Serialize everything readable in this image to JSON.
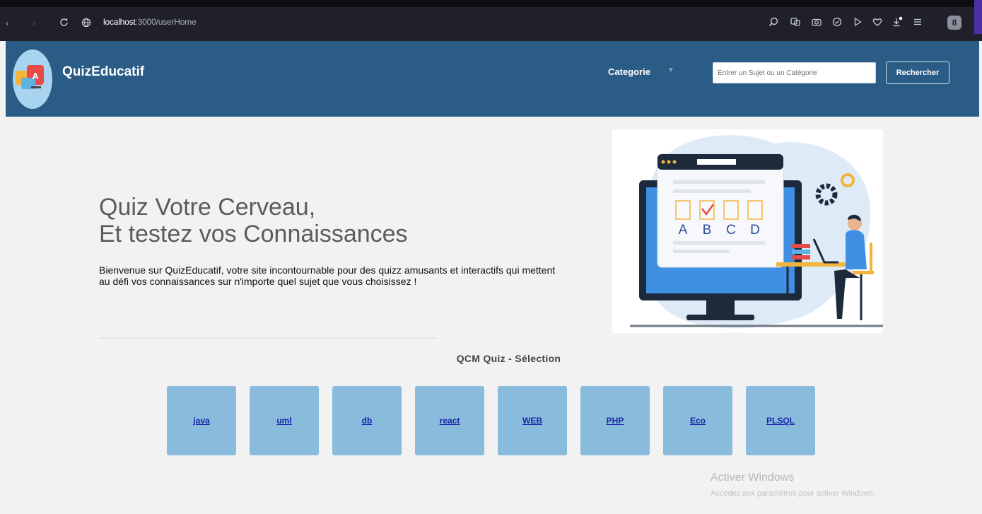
{
  "browser": {
    "url_host": "localhost",
    "url_path": ":3000/userHome",
    "profile_initial": "8",
    "toolbar_icons": [
      "zoom-icon",
      "translate-icon",
      "camera-icon",
      "check-circle-icon",
      "play-icon",
      "heart-icon",
      "download-icon",
      "menu-icon"
    ]
  },
  "header": {
    "brand": "QuizEducatif",
    "nav_category": "Categorie",
    "search_placeholder": "Entrer un Sujet ou un Catégorie",
    "search_button": "Rechercher"
  },
  "hero": {
    "title_line1": "Quiz Votre Cerveau,",
    "title_line2": "Et testez vos Connaissances",
    "description": "Bienvenue sur QuizEducatif, votre site incontournable pour des quizz amusants et interactifs qui mettent au défi vos connaissances sur n'importe quel sujet que vous choisissez !",
    "illustration_letters": [
      "A",
      "B",
      "C",
      "D"
    ]
  },
  "quiz_section": {
    "title": "QCM Quiz - Sélection",
    "cards": [
      "java",
      "uml",
      "db",
      "react",
      "WEB",
      "PHP",
      "Eco",
      "PLSQL"
    ]
  },
  "watermark": {
    "line1": "Activer Windows",
    "line2": "Accédez aux paramètres pour activer Windows."
  },
  "colors": {
    "header_bg": "#2b5c86",
    "card_bg": "#88bbdc",
    "link": "#1c24a8"
  }
}
